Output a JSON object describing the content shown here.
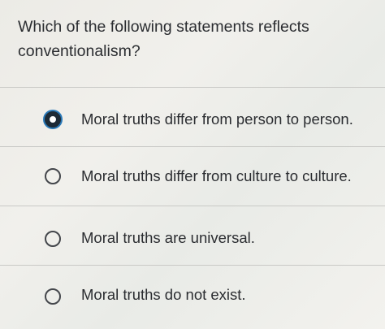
{
  "question": {
    "text": "Which of the following statements reflects conventionalism?"
  },
  "options": [
    {
      "label": "Moral truths differ from person to person.",
      "selected": true
    },
    {
      "label": "Moral truths differ from culture to culture.",
      "selected": false
    },
    {
      "label": "Moral truths are universal.",
      "selected": false
    },
    {
      "label": "Moral truths do not exist.",
      "selected": false
    }
  ],
  "colors": {
    "text": "#2b2d31",
    "divider": "#c9c9c6",
    "selected_focus": "#2a79b8",
    "selected_fill": "#1d2a36"
  }
}
